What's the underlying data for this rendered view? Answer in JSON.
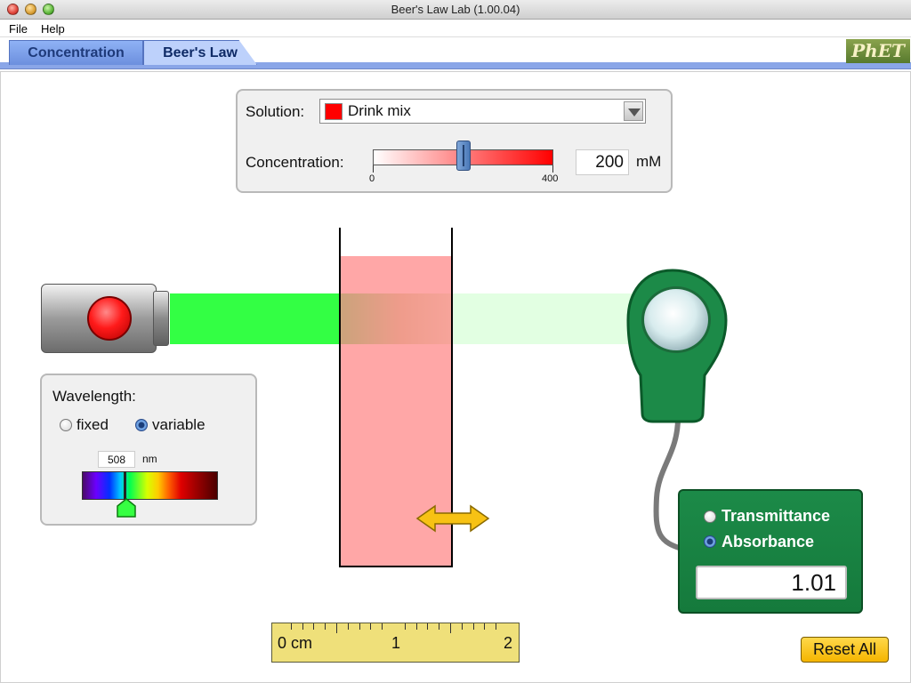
{
  "window": {
    "title": "Beer's Law Lab (1.00.04)"
  },
  "menu": {
    "items": [
      "File",
      "Help"
    ]
  },
  "tabs": [
    {
      "label": "Concentration",
      "selected": false
    },
    {
      "label": "Beer's Law",
      "selected": true
    }
  ],
  "logo": {
    "text": "PhET"
  },
  "solution_panel": {
    "solution_label": "Solution:",
    "solution_value": "Drink mix",
    "solution_color": "#ff0000",
    "concentration_label": "Concentration:",
    "slider_min_label": "0",
    "slider_max_label": "400",
    "slider_fraction": 0.5,
    "concentration_value": "200",
    "concentration_units": "mM"
  },
  "wavelength_panel": {
    "title": "Wavelength:",
    "options": [
      {
        "label": "fixed",
        "selected": false
      },
      {
        "label": "variable",
        "selected": true
      }
    ],
    "value": "508",
    "units": "nm"
  },
  "meter": {
    "options": [
      {
        "label": "Transmittance",
        "selected": false
      },
      {
        "label": "Absorbance",
        "selected": true
      }
    ],
    "readout": "1.01"
  },
  "ruler": {
    "labels": [
      "0 cm",
      "1",
      "2"
    ]
  },
  "reset_label": "Reset All",
  "colors": {
    "beam": "#33ff44",
    "solution": "#ff8282",
    "meter": "#1c8a48",
    "reset": "#f5b500"
  }
}
